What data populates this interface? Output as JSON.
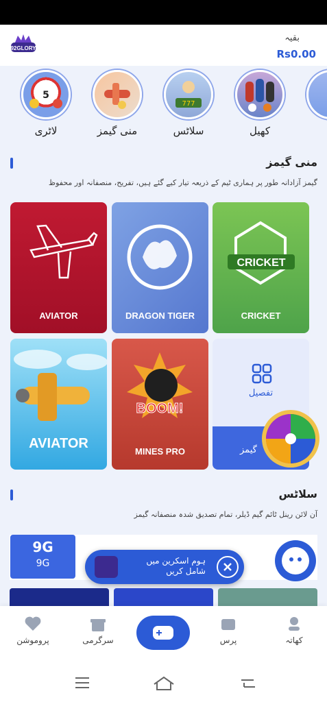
{
  "header": {
    "balance_label": "بقیہ",
    "balance_value": "Rs0.00"
  },
  "categories": [
    {
      "label": "لاٹری"
    },
    {
      "label": "منی گیمز"
    },
    {
      "label": "سلاٹس"
    },
    {
      "label": "کھیل"
    }
  ],
  "mini_games": {
    "title": "منی گیمز",
    "description": "گیمز آزادانہ طور پر ہماری ٹیم کے ذریعہ تیار کیے گئے ہیں، تفریح، منصفانہ اور محفوظ",
    "tiles": [
      {
        "label": "CRICKET",
        "color": "#59b548"
      },
      {
        "label": "DRAGON TIGER",
        "color": "#6f93de"
      },
      {
        "label": "AVIATOR",
        "color": "#b5152e"
      },
      {
        "label": "تفصیل",
        "color": "#e6ebfb"
      },
      {
        "label": "MINES PRO",
        "color": "#c94a3a"
      },
      {
        "label": "AVIATOR",
        "color": "#37b6e9"
      }
    ],
    "more_label": "گیمز"
  },
  "slots": {
    "title": "سلاٹس",
    "description": "آن لائن رینل ٹائم گیم ڈیلر، تمام تصدیق شدہ منصفانہ گیمز",
    "first_tile_label": "9G"
  },
  "banner": {
    "line1": "ہوم اسکرین میں",
    "line2": "شامل کریں"
  },
  "bottom_nav": {
    "items": [
      {
        "label": "کھاتہ"
      },
      {
        "label": "پرس"
      },
      {
        "label": "سرگرمی"
      },
      {
        "label": "پروموشن"
      }
    ]
  }
}
